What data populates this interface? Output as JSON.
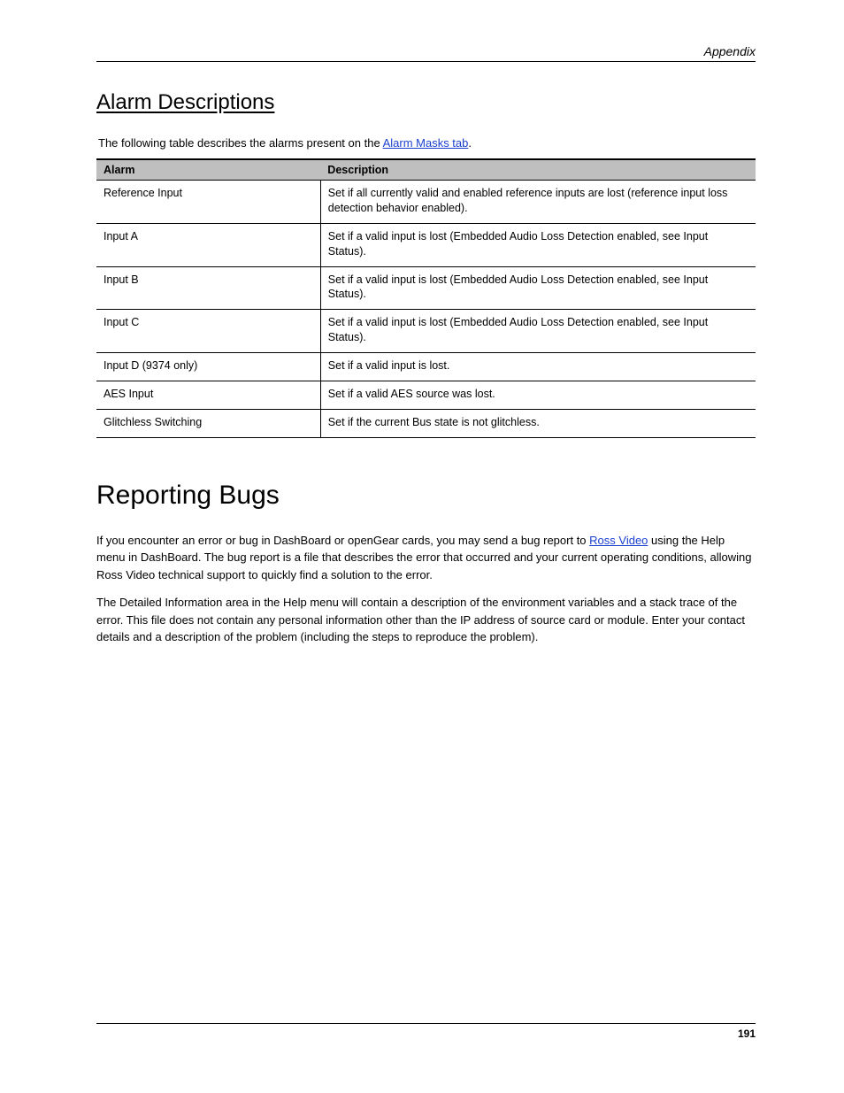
{
  "running_head": "Appendix",
  "page_number": "191",
  "alarm_section": {
    "heading": "Alarm Descriptions",
    "intro_prefix": "The following table describes the alarms present on the ",
    "intro_link": "Alarm Masks tab",
    "intro_suffix": ".",
    "columns": [
      "Alarm",
      "Description"
    ],
    "rows": [
      {
        "alarm": "Reference Input",
        "desc": "Set if all currently valid and enabled reference inputs are lost (reference input loss detection behavior enabled)."
      },
      {
        "alarm": "Input A",
        "desc": "Set if a valid input is lost (Embedded Audio Loss Detection enabled, see Input Status)."
      },
      {
        "alarm": "Input B",
        "desc": "Set if a valid input is lost (Embedded Audio Loss Detection enabled, see Input Status)."
      },
      {
        "alarm": "Input C",
        "desc": "Set if a valid input is lost (Embedded Audio Loss Detection enabled, see Input Status)."
      },
      {
        "alarm": "Input D (9374 only)",
        "desc": "Set if a valid input is lost."
      },
      {
        "alarm": "AES Input",
        "desc": "Set if a valid AES source was lost."
      },
      {
        "alarm": "Glitchless Switching",
        "desc": "Set if the current Bus state is not glitchless."
      }
    ]
  },
  "bugs_section": {
    "heading": "Reporting Bugs",
    "p1_prefix": "If you encounter an error or bug in DashBoard or openGear cards, you may send a bug report to ",
    "p1_link": "Ross Video",
    "p1_suffix": " using the Help menu in DashBoard. The bug report is a file that describes the error that occurred and your current operating conditions, allowing Ross Video technical support to quickly find a solution to the error.",
    "p2": "The Detailed Information area in the Help menu will contain a description of the environment variables and a stack trace of the error. This file does not contain any personal information other than the IP address of source card or module. Enter your contact details and a description of the problem (including the steps to reproduce the problem)."
  }
}
